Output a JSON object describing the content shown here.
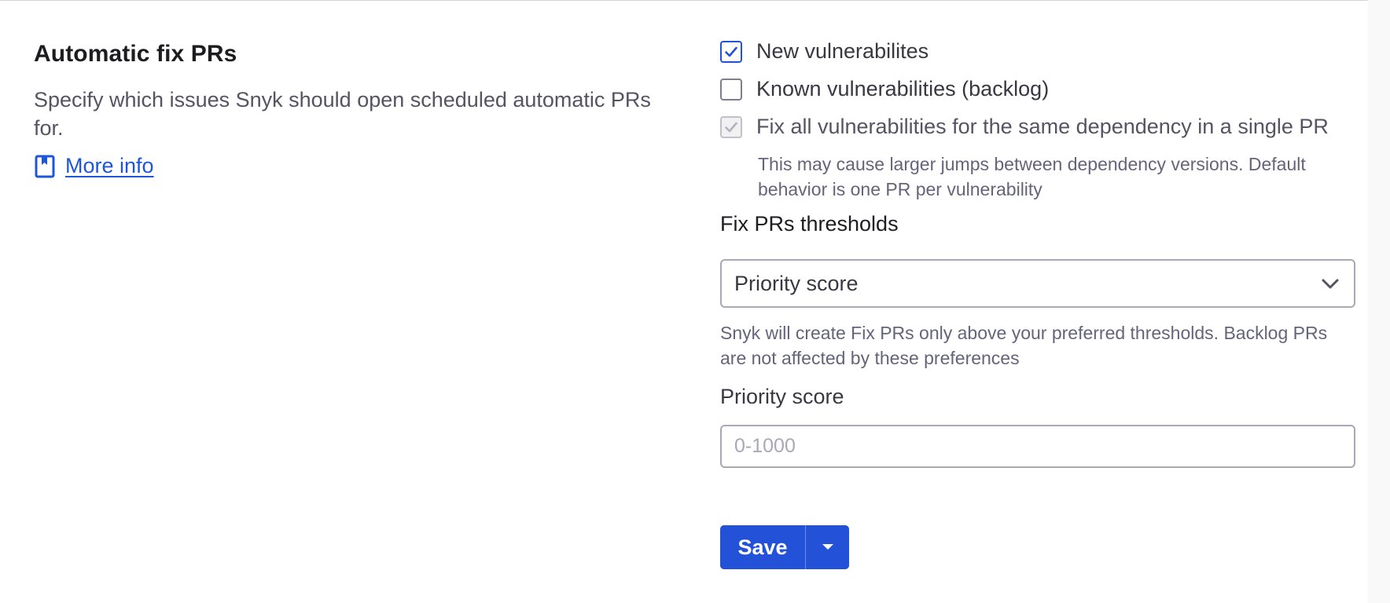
{
  "section": {
    "title": "Automatic fix PRs",
    "description": "Specify which issues Snyk should open scheduled automatic PRs for.",
    "more_info_label": "More info"
  },
  "options": [
    {
      "label": "New vulnerabilites",
      "checked": true,
      "disabled": false
    },
    {
      "label": "Known vulnerabilities (backlog)",
      "checked": false,
      "disabled": false
    },
    {
      "label": "Fix all vulnerabilities for the same dependency in a single PR",
      "checked": true,
      "disabled": true
    }
  ],
  "options_hint": "This may cause larger jumps between dependency versions. Default behavior is one PR per vulnerability",
  "thresholds": {
    "label": "Fix PRs thresholds",
    "selected": "Priority score",
    "help": "Snyk will create Fix PRs only above your preferred thresholds. Backlog PRs are not affected by these preferences"
  },
  "priority_score": {
    "label": "Priority score",
    "value": "",
    "placeholder": "0-1000"
  },
  "actions": {
    "save_label": "Save"
  },
  "colors": {
    "accent": "#2352d9",
    "link": "#1f55d9",
    "muted_text": "#65647a"
  },
  "icons": {
    "more_info": "book-icon",
    "select": "chevron-down-icon",
    "split": "caret-down-icon",
    "check": "checkmark-icon"
  }
}
